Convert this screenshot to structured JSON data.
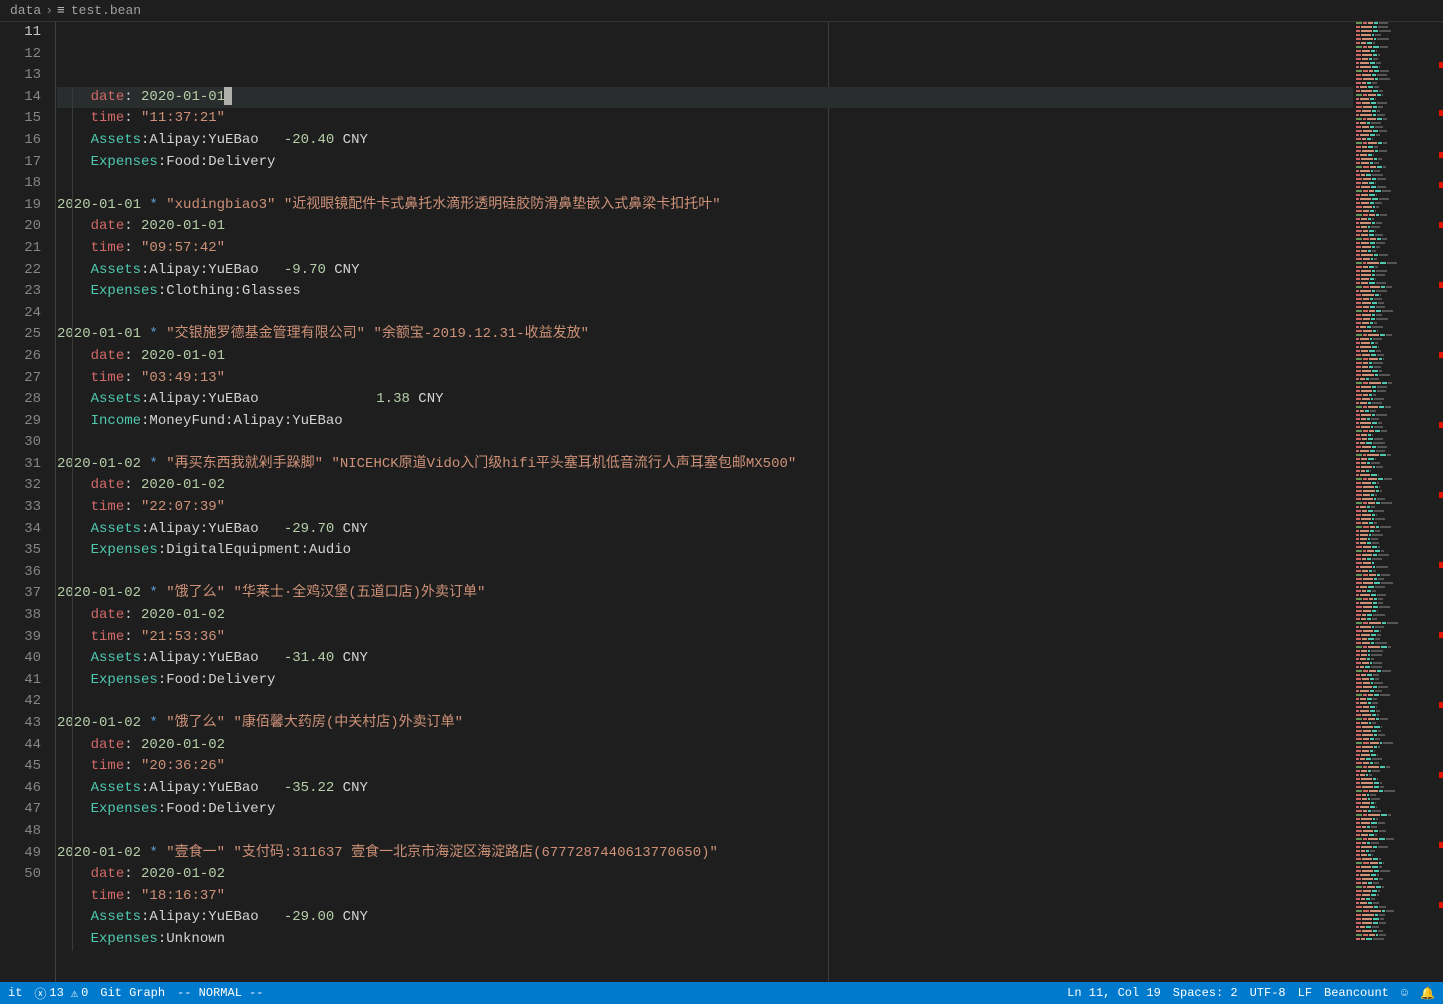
{
  "breadcrumb": {
    "folder": "data",
    "file": "test.bean"
  },
  "editor": {
    "startLine": 11,
    "currentLine": 11,
    "lines": [
      {
        "n": 11,
        "hl": true,
        "segs": [
          [
            "ind",
            "    "
          ],
          [
            "key",
            "date"
          ],
          [
            "white",
            ": "
          ],
          [
            "date",
            "2020-01-01"
          ],
          [
            "cursor",
            "|"
          ]
        ]
      },
      {
        "n": 12,
        "segs": [
          [
            "ind",
            "    "
          ],
          [
            "key",
            "time"
          ],
          [
            "white",
            ": "
          ],
          [
            "string",
            "\"11:37:21\""
          ]
        ]
      },
      {
        "n": 13,
        "segs": [
          [
            "ind",
            "    "
          ],
          [
            "account",
            "Assets"
          ],
          [
            "white",
            ":Alipay:YuEBao   "
          ],
          [
            "num",
            "-20.40"
          ],
          [
            "white",
            " CNY"
          ]
        ]
      },
      {
        "n": 14,
        "segs": [
          [
            "ind",
            "    "
          ],
          [
            "account",
            "Expenses"
          ],
          [
            "white",
            ":Food:Delivery"
          ]
        ]
      },
      {
        "n": 15,
        "segs": []
      },
      {
        "n": 16,
        "segs": [
          [
            "header",
            "2020-01-01"
          ],
          [
            "white",
            " "
          ],
          [
            "star",
            "*"
          ],
          [
            "white",
            " "
          ],
          [
            "string",
            "\"xudingbiao3\""
          ],
          [
            "white",
            " "
          ],
          [
            "string",
            "\"近视眼镜配件卡式鼻托水滴形透明硅胶防滑鼻垫嵌入式鼻梁卡扣托叶\""
          ]
        ]
      },
      {
        "n": 17,
        "segs": [
          [
            "ind",
            "    "
          ],
          [
            "key",
            "date"
          ],
          [
            "white",
            ": "
          ],
          [
            "date",
            "2020-01-01"
          ]
        ]
      },
      {
        "n": 18,
        "segs": [
          [
            "ind",
            "    "
          ],
          [
            "key",
            "time"
          ],
          [
            "white",
            ": "
          ],
          [
            "string",
            "\"09:57:42\""
          ]
        ]
      },
      {
        "n": 19,
        "segs": [
          [
            "ind",
            "    "
          ],
          [
            "account",
            "Assets"
          ],
          [
            "white",
            ":Alipay:YuEBao   "
          ],
          [
            "num",
            "-9.70"
          ],
          [
            "white",
            " CNY"
          ]
        ]
      },
      {
        "n": 20,
        "segs": [
          [
            "ind",
            "    "
          ],
          [
            "account",
            "Expenses"
          ],
          [
            "white",
            ":Clothing:Glasses"
          ]
        ]
      },
      {
        "n": 21,
        "segs": []
      },
      {
        "n": 22,
        "segs": [
          [
            "header",
            "2020-01-01"
          ],
          [
            "white",
            " "
          ],
          [
            "star",
            "*"
          ],
          [
            "white",
            " "
          ],
          [
            "string",
            "\"交银施罗德基金管理有限公司\""
          ],
          [
            "white",
            " "
          ],
          [
            "string",
            "\"余额宝-2019.12.31-收益发放\""
          ]
        ]
      },
      {
        "n": 23,
        "segs": [
          [
            "ind",
            "    "
          ],
          [
            "key",
            "date"
          ],
          [
            "white",
            ": "
          ],
          [
            "date",
            "2020-01-01"
          ]
        ]
      },
      {
        "n": 24,
        "segs": [
          [
            "ind",
            "    "
          ],
          [
            "key",
            "time"
          ],
          [
            "white",
            ": "
          ],
          [
            "string",
            "\"03:49:13\""
          ]
        ]
      },
      {
        "n": 25,
        "segs": [
          [
            "ind",
            "    "
          ],
          [
            "account",
            "Assets"
          ],
          [
            "white",
            ":Alipay:YuEBao              "
          ],
          [
            "num",
            "1.38"
          ],
          [
            "white",
            " CNY"
          ]
        ]
      },
      {
        "n": 26,
        "segs": [
          [
            "ind",
            "    "
          ],
          [
            "account",
            "Income"
          ],
          [
            "white",
            ":MoneyFund:Alipay:YuEBao"
          ]
        ]
      },
      {
        "n": 27,
        "segs": []
      },
      {
        "n": 28,
        "segs": [
          [
            "header",
            "2020-01-02"
          ],
          [
            "white",
            " "
          ],
          [
            "star",
            "*"
          ],
          [
            "white",
            " "
          ],
          [
            "string",
            "\"再买东西我就剁手跺脚\""
          ],
          [
            "white",
            " "
          ],
          [
            "string",
            "\"NICEHCK原道Vido入门级hifi平头塞耳机低音流行人声耳塞包邮MX500\""
          ]
        ]
      },
      {
        "n": 29,
        "segs": [
          [
            "ind",
            "    "
          ],
          [
            "key",
            "date"
          ],
          [
            "white",
            ": "
          ],
          [
            "date",
            "2020-01-02"
          ]
        ]
      },
      {
        "n": 30,
        "segs": [
          [
            "ind",
            "    "
          ],
          [
            "key",
            "time"
          ],
          [
            "white",
            ": "
          ],
          [
            "string",
            "\"22:07:39\""
          ]
        ]
      },
      {
        "n": 31,
        "segs": [
          [
            "ind",
            "    "
          ],
          [
            "account",
            "Assets"
          ],
          [
            "white",
            ":Alipay:YuEBao   "
          ],
          [
            "num",
            "-29.70"
          ],
          [
            "white",
            " CNY"
          ]
        ]
      },
      {
        "n": 32,
        "segs": [
          [
            "ind",
            "    "
          ],
          [
            "account",
            "Expenses"
          ],
          [
            "white",
            ":DigitalEquipment:Audio"
          ]
        ]
      },
      {
        "n": 33,
        "segs": []
      },
      {
        "n": 34,
        "segs": [
          [
            "header",
            "2020-01-02"
          ],
          [
            "white",
            " "
          ],
          [
            "star",
            "*"
          ],
          [
            "white",
            " "
          ],
          [
            "string",
            "\"饿了么\""
          ],
          [
            "white",
            " "
          ],
          [
            "string",
            "\"华莱士·全鸡汉堡(五道口店)外卖订单\""
          ]
        ]
      },
      {
        "n": 35,
        "segs": [
          [
            "ind",
            "    "
          ],
          [
            "key",
            "date"
          ],
          [
            "white",
            ": "
          ],
          [
            "date",
            "2020-01-02"
          ]
        ]
      },
      {
        "n": 36,
        "segs": [
          [
            "ind",
            "    "
          ],
          [
            "key",
            "time"
          ],
          [
            "white",
            ": "
          ],
          [
            "string",
            "\"21:53:36\""
          ]
        ]
      },
      {
        "n": 37,
        "segs": [
          [
            "ind",
            "    "
          ],
          [
            "account",
            "Assets"
          ],
          [
            "white",
            ":Alipay:YuEBao   "
          ],
          [
            "num",
            "-31.40"
          ],
          [
            "white",
            " CNY"
          ]
        ]
      },
      {
        "n": 38,
        "segs": [
          [
            "ind",
            "    "
          ],
          [
            "account",
            "Expenses"
          ],
          [
            "white",
            ":Food:Delivery"
          ]
        ]
      },
      {
        "n": 39,
        "segs": []
      },
      {
        "n": 40,
        "segs": [
          [
            "header",
            "2020-01-02"
          ],
          [
            "white",
            " "
          ],
          [
            "star",
            "*"
          ],
          [
            "white",
            " "
          ],
          [
            "string",
            "\"饿了么\""
          ],
          [
            "white",
            " "
          ],
          [
            "string",
            "\"康佰馨大药房(中关村店)外卖订单\""
          ]
        ]
      },
      {
        "n": 41,
        "segs": [
          [
            "ind",
            "    "
          ],
          [
            "key",
            "date"
          ],
          [
            "white",
            ": "
          ],
          [
            "date",
            "2020-01-02"
          ]
        ]
      },
      {
        "n": 42,
        "segs": [
          [
            "ind",
            "    "
          ],
          [
            "key",
            "time"
          ],
          [
            "white",
            ": "
          ],
          [
            "string",
            "\"20:36:26\""
          ]
        ]
      },
      {
        "n": 43,
        "segs": [
          [
            "ind",
            "    "
          ],
          [
            "account",
            "Assets"
          ],
          [
            "white",
            ":Alipay:YuEBao   "
          ],
          [
            "num",
            "-35.22"
          ],
          [
            "white",
            " CNY"
          ]
        ]
      },
      {
        "n": 44,
        "segs": [
          [
            "ind",
            "    "
          ],
          [
            "account",
            "Expenses"
          ],
          [
            "white",
            ":Food:Delivery"
          ]
        ]
      },
      {
        "n": 45,
        "segs": []
      },
      {
        "n": 46,
        "segs": [
          [
            "header",
            "2020-01-02"
          ],
          [
            "white",
            " "
          ],
          [
            "star",
            "*"
          ],
          [
            "white",
            " "
          ],
          [
            "string",
            "\"壹食一\""
          ],
          [
            "white",
            " "
          ],
          [
            "string",
            "\"支付码:311637 壹食一北京市海淀区海淀路店(6777287440613770650)\""
          ]
        ]
      },
      {
        "n": 47,
        "segs": [
          [
            "ind",
            "    "
          ],
          [
            "key",
            "date"
          ],
          [
            "white",
            ": "
          ],
          [
            "date",
            "2020-01-02"
          ]
        ]
      },
      {
        "n": 48,
        "segs": [
          [
            "ind",
            "    "
          ],
          [
            "key",
            "time"
          ],
          [
            "white",
            ": "
          ],
          [
            "string",
            "\"18:16:37\""
          ]
        ]
      },
      {
        "n": 49,
        "segs": [
          [
            "ind",
            "    "
          ],
          [
            "account",
            "Assets"
          ],
          [
            "white",
            ":Alipay:YuEBao   "
          ],
          [
            "num",
            "-29.00"
          ],
          [
            "white",
            " CNY"
          ]
        ]
      },
      {
        "n": 50,
        "segs": [
          [
            "ind",
            "    "
          ],
          [
            "account",
            "Expenses"
          ],
          [
            "white",
            ":Unknown"
          ]
        ]
      }
    ]
  },
  "statusbar": {
    "git": "it",
    "errors": "13",
    "warnings": "0",
    "gitgraph": "Git Graph",
    "vimmode": "-- NORMAL --",
    "position": "Ln 11, Col 19",
    "spaces": "Spaces: 2",
    "encoding": "UTF-8",
    "eol": "LF",
    "language": "Beancount"
  }
}
